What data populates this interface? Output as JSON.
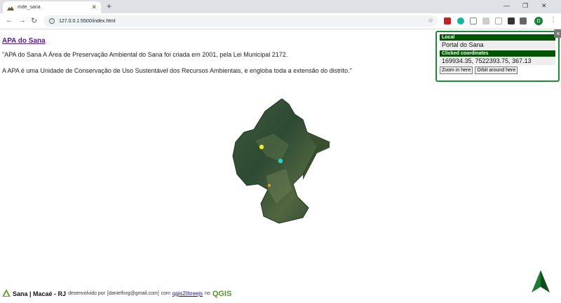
{
  "browser": {
    "tab_title": "mde_sana",
    "url": "127.0.0.1:5500/index.html",
    "profile_initial": "D"
  },
  "page": {
    "title": "APA do Sana",
    "paragraph1": "\"APA do Sana A Área de Preservação Ambiental do Sana foi criada em 2001, pela Lei Municipal 2172.",
    "paragraph2": "A APA é uma Unidade de Conservação de Uso Sustentável dos Recursos Ambientais, e engloba toda a extensão do distrito.\""
  },
  "popup": {
    "local_header": "Local",
    "local_value": "Portal do Sana",
    "coords_header": "Clicked coordinates",
    "coords_value": "169934.35, 7522393.75, 367.13",
    "zoom_button": "Zoom in here",
    "orbit_button": "Orbit around here",
    "close_label": "×"
  },
  "footer": {
    "brand": "Sana | Macaé - RJ",
    "dev_text": "desenvolvido por",
    "email": "[danielforg@gmail.com]",
    "with_text": "com",
    "plugin_link": "qgis2threejs",
    "in_text": "no",
    "qgis": "QGIS"
  },
  "colors": {
    "accent_green": "#1e8c32",
    "header_green": "#005500",
    "link_purple": "#551a8b"
  }
}
